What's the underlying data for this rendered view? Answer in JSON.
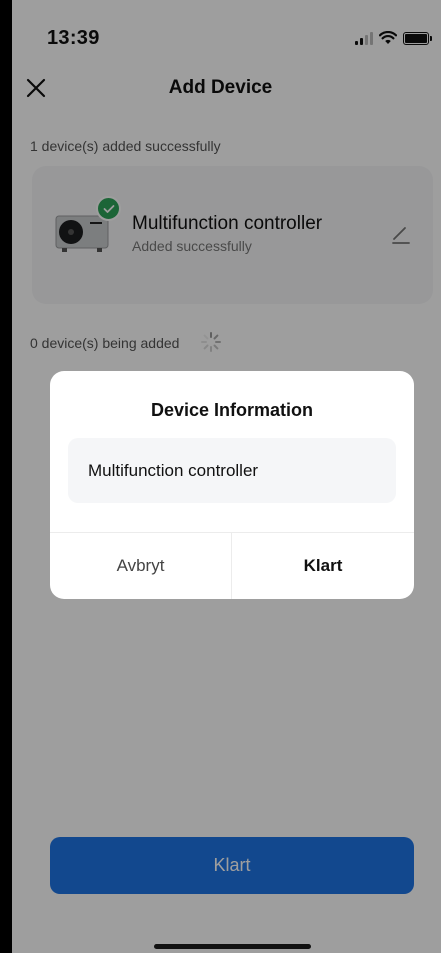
{
  "status_bar": {
    "time": "13:39",
    "icons": [
      "signal-icon",
      "wifi-icon",
      "battery-icon"
    ]
  },
  "header": {
    "close_icon": "close-icon",
    "title": "Add Device"
  },
  "added_section": {
    "label": "1 device(s) added successfully",
    "devices": [
      {
        "name": "Multifunction controller",
        "status": "Added successfully",
        "image_icon": "heat-pump-device-icon",
        "badge_icon": "check-icon",
        "action_icon": "edit-icon"
      }
    ]
  },
  "adding_section": {
    "label": "0 device(s) being added",
    "spinner_icon": "loading-spinner-icon"
  },
  "bottom_button": {
    "label": "Klart"
  },
  "dialog": {
    "title": "Device Information",
    "input_value": "Multifunction controller",
    "cancel_label": "Avbryt",
    "confirm_label": "Klart"
  },
  "colors": {
    "accent": "#1e74e6",
    "success": "#2ea45a",
    "card_bg": "#f5f6f7"
  }
}
